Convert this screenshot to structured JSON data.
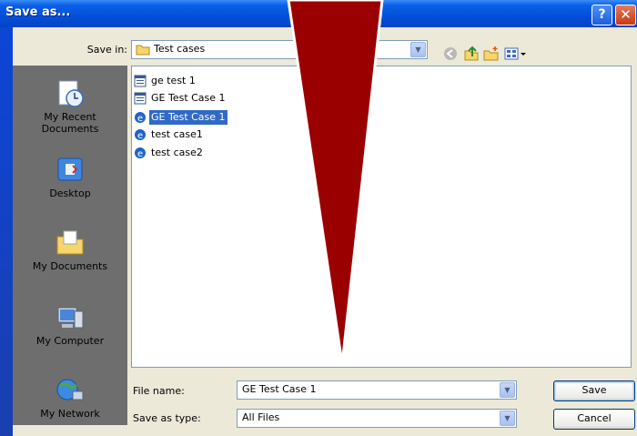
{
  "window": {
    "title": "Save as..."
  },
  "toolbar": {
    "save_in_label": "Save in:",
    "save_in_value": "Test cases"
  },
  "places": [
    {
      "label_line1": "My Recent",
      "label_line2": "Documents",
      "icon": "recent-documents-icon"
    },
    {
      "label_line1": "Desktop",
      "label_line2": "",
      "icon": "desktop-icon"
    },
    {
      "label_line1": "My Documents",
      "label_line2": "",
      "icon": "my-documents-icon"
    },
    {
      "label_line1": "My Computer",
      "label_line2": "",
      "icon": "my-computer-icon"
    },
    {
      "label_line1": "My Network",
      "label_line2": "",
      "icon": "my-network-icon"
    }
  ],
  "files": [
    {
      "name": "ge test 1",
      "icon": "document-icon",
      "selected": false
    },
    {
      "name": "GE Test Case 1",
      "icon": "document-icon",
      "selected": false
    },
    {
      "name": "GE Test Case 1",
      "icon": "ie-html-icon",
      "selected": true
    },
    {
      "name": "test case1",
      "icon": "ie-html-icon",
      "selected": false
    },
    {
      "name": "test case2",
      "icon": "ie-html-icon",
      "selected": false
    }
  ],
  "bottom": {
    "file_name_label": "File name:",
    "file_name_value": "GE Test Case 1",
    "save_as_type_label": "Save as type:",
    "save_as_type_value": "All Files",
    "save_button": "Save",
    "cancel_button": "Cancel"
  },
  "colors": {
    "titlebar": "#0450d8",
    "selection": "#316ac5",
    "overlay_arrow": "#9a0000"
  }
}
